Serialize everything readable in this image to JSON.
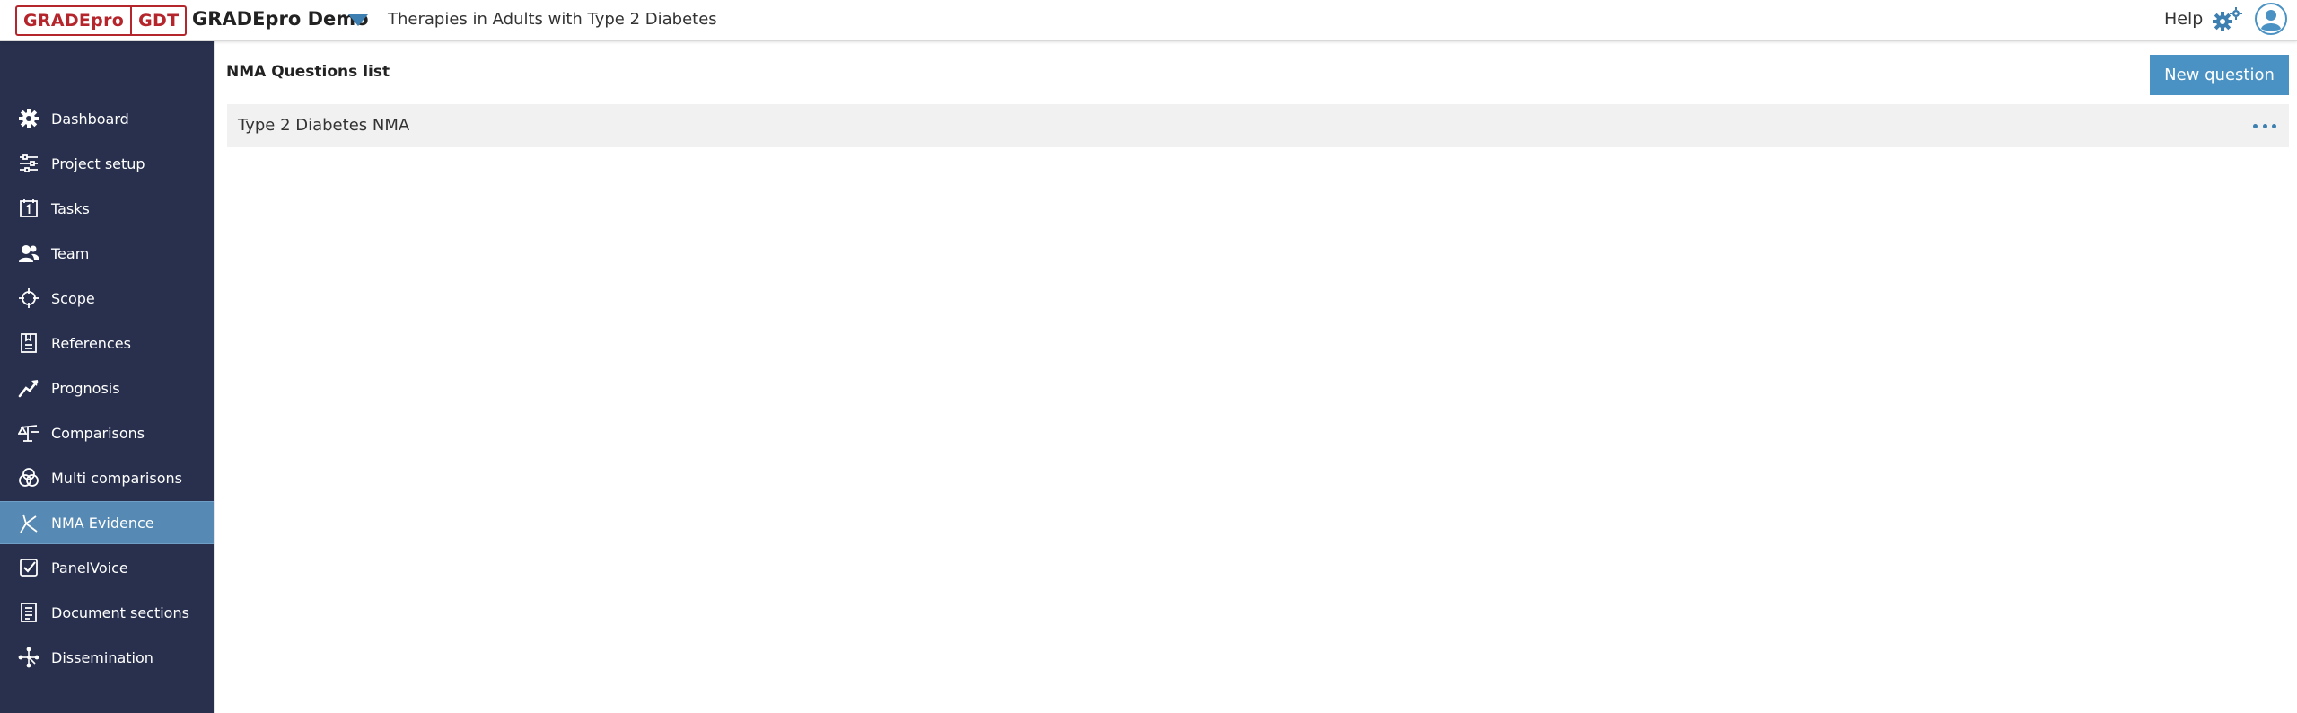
{
  "header": {
    "logo_left": "GRADEpro",
    "logo_right": "GDT",
    "project_name": "GRADEpro Demo",
    "project_title": "Therapies in Adults with Type 2 Diabetes",
    "help_label": "Help",
    "icons": {
      "project_menu": "caret-down-icon",
      "settings": "gears-icon",
      "user": "user-avatar-icon"
    },
    "colors": {
      "logo_red": "#b5262c",
      "accent_blue": "#3c7fb0"
    }
  },
  "sidebar": {
    "colors": {
      "background": "#28304e",
      "active": "#5689b3"
    },
    "items": [
      {
        "label": "Dashboard",
        "icon": "gear-icon",
        "active": false
      },
      {
        "label": "Project setup",
        "icon": "sliders-icon",
        "active": false
      },
      {
        "label": "Tasks",
        "icon": "calendar-icon",
        "active": false
      },
      {
        "label": "Team",
        "icon": "team-icon",
        "active": false
      },
      {
        "label": "Scope",
        "icon": "crosshair-icon",
        "active": false
      },
      {
        "label": "References",
        "icon": "references-icon",
        "active": false
      },
      {
        "label": "Prognosis",
        "icon": "trend-icon",
        "active": false
      },
      {
        "label": "Comparisons",
        "icon": "scale-icon",
        "active": false
      },
      {
        "label": "Multi comparisons",
        "icon": "venn-icon",
        "active": false
      },
      {
        "label": "NMA Evidence",
        "icon": "network-icon",
        "active": true
      },
      {
        "label": "PanelVoice",
        "icon": "checkbox-icon",
        "active": false
      },
      {
        "label": "Document sections",
        "icon": "document-icon",
        "active": false
      },
      {
        "label": "Dissemination",
        "icon": "share-nodes-icon",
        "active": false
      }
    ]
  },
  "main": {
    "title": "NMA Questions list",
    "new_question_label": "New question",
    "questions": [
      {
        "title": "Type 2 Diabetes NMA",
        "menu_icon": "more-horizontal-icon"
      }
    ],
    "colors": {
      "button": "#4a92c3",
      "row": "#f1f1f1"
    }
  }
}
